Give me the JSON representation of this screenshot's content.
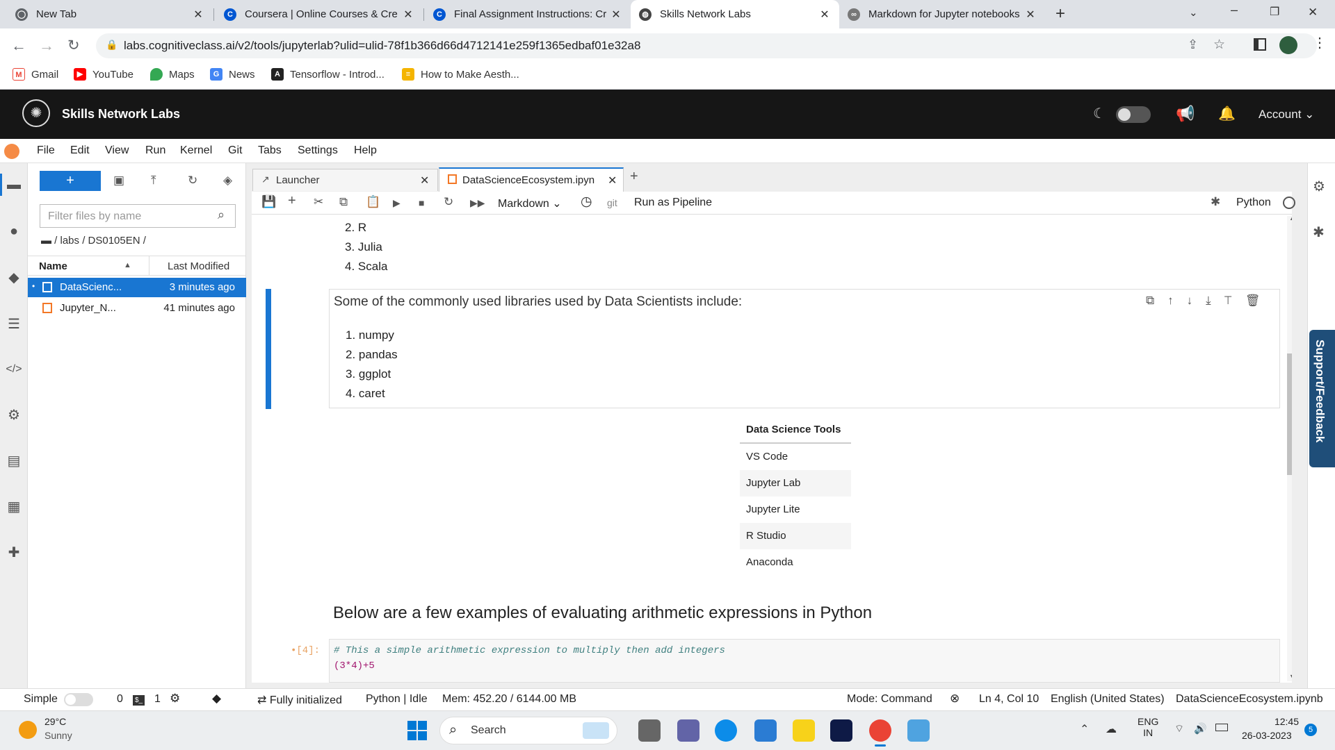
{
  "browser": {
    "tabs": [
      {
        "title": "New Tab",
        "color": "#5f6368"
      },
      {
        "title": "Coursera | Online Courses & Cre",
        "color": "#0056d2"
      },
      {
        "title": "Final Assignment Instructions: Cr",
        "color": "#0056d2"
      },
      {
        "title": "Skills Network Labs",
        "color": "#444"
      },
      {
        "title": "Markdown for Jupyter notebooks",
        "color": "#777"
      }
    ],
    "url": "labs.cognitiveclass.ai/v2/tools/jupyterlab?ulid=ulid-78f1b366d66d4712141e259f1365edbaf01e32a8",
    "bookmarks": [
      {
        "label": "Gmail",
        "icon": "gmail-icon"
      },
      {
        "label": "YouTube",
        "icon": "youtube-icon"
      },
      {
        "label": "Maps",
        "icon": "maps-icon"
      },
      {
        "label": "News",
        "icon": "news-icon"
      },
      {
        "label": "Tensorflow - Introd...",
        "icon": "tensorflow-icon"
      },
      {
        "label": "How to Make Aesth...",
        "icon": "page-icon"
      }
    ]
  },
  "app": {
    "title": "Skills Network Labs",
    "account": "Account"
  },
  "menu": [
    "File",
    "Edit",
    "View",
    "Run",
    "Kernel",
    "Git",
    "Tabs",
    "Settings",
    "Help"
  ],
  "filebrowser": {
    "filter_placeholder": "Filter files by name",
    "breadcrumb": "/ labs / DS0105EN /",
    "col_name": "Name",
    "col_modified": "Last Modified",
    "files": [
      {
        "name": "DataScienc...",
        "modified": "3 minutes ago"
      },
      {
        "name": "Jupyter_N...",
        "modified": "41 minutes ago"
      }
    ]
  },
  "doc_tabs": {
    "launcher": "Launcher",
    "notebook": "DataScienceEcosystem.ipyn"
  },
  "toolbar": {
    "cell_type": "Markdown",
    "git": "git",
    "pipeline": "Run as Pipeline",
    "kernel": "Python"
  },
  "notebook": {
    "languages": [
      "R",
      "Julia",
      "Scala"
    ],
    "languages_start": 2,
    "libraries_intro": "Some of the commonly used libraries used by Data Scientists include:",
    "libraries": [
      "numpy",
      "pandas",
      "ggplot",
      "caret"
    ],
    "tools_header": "Data Science Tools",
    "tools": [
      "VS Code",
      "Jupyter Lab",
      "Jupyter Lite",
      "R Studio",
      "Anaconda"
    ],
    "heading": "Below are a few examples of evaluating arithmetic expressions in Python",
    "code_prompt": "•[4]:",
    "code_comment": "# This a simple arithmetic expression to multiply then add integers",
    "code_line": "(3*4)+5"
  },
  "support": "Support/Feedback",
  "status": {
    "mode_label": "Simple",
    "zero": "0",
    "one": "1",
    "init": "Fully initialized",
    "kernel": "Python | Idle",
    "mem": "Mem: 452.20 / 6144.00 MB",
    "cmd": "Mode: Command",
    "pos": "Ln 4, Col 10",
    "lang": "English (United States)",
    "file": "DataScienceEcosystem.ipynb"
  },
  "taskbar": {
    "temp": "29°C",
    "weather": "Sunny",
    "search": "Search",
    "lang1": "ENG",
    "lang2": "IN",
    "time": "12:45",
    "date": "26-03-2023",
    "badge": "5"
  }
}
